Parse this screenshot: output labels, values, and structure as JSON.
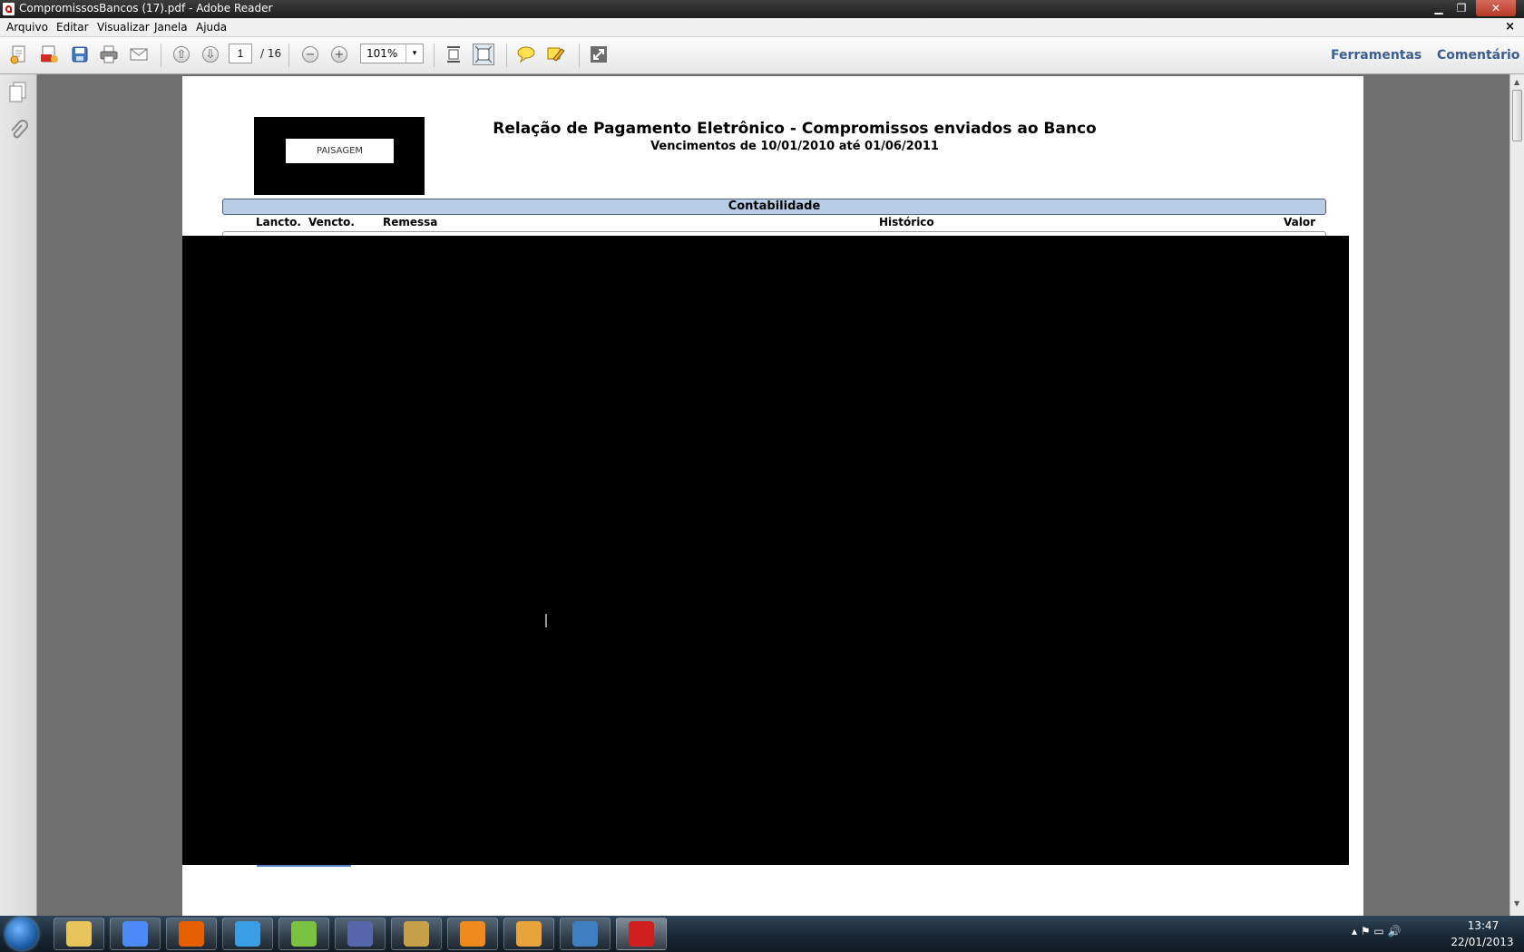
{
  "window": {
    "title": "CompromissosBancos (17).pdf - Adobe Reader",
    "min": "▁",
    "max": "❐",
    "close": "✕"
  },
  "menu": {
    "items": [
      "Arquivo",
      "Editar",
      "Visualizar",
      "Janela",
      "Ajuda"
    ],
    "close": "×"
  },
  "toolbar": {
    "page_current": "1",
    "page_total": "/ 16",
    "zoom": "101%",
    "zoom_arrow": "▾",
    "tools_label": "Ferramentas",
    "comment_label": "Comentário",
    "prev_glyph": "⇧",
    "next_glyph": "⇩",
    "zoom_out_glyph": "−",
    "zoom_in_glyph": "+"
  },
  "document": {
    "logo_text": "PAISAGEM",
    "title": "Relação de Pagamento Eletrônico - Compromissos enviados ao Banco",
    "subtitle": "Vencimentos de 10/01/2010 até 01/06/2011",
    "section": "Contabilidade",
    "columns": [
      "Lancto.",
      "Vencto.",
      "Remessa",
      "Histórico",
      "Valor"
    ]
  },
  "scrollbar": {
    "up": "▲",
    "down": "▼"
  },
  "taskbar": {
    "apps": [
      {
        "name": "explorer",
        "color": "#e8c45a",
        "active": false
      },
      {
        "name": "chrome",
        "color": "#4c8bf5",
        "active": false
      },
      {
        "name": "firefox",
        "color": "#e66000",
        "active": false
      },
      {
        "name": "internet-explorer",
        "color": "#3a9ee4",
        "active": false
      },
      {
        "name": "notepad",
        "color": "#7cc242",
        "active": false
      },
      {
        "name": "infinity",
        "color": "#5566aa",
        "active": false
      },
      {
        "name": "tools",
        "color": "#c9a04a",
        "active": false
      },
      {
        "name": "flame",
        "color": "#f08a1c",
        "active": false
      },
      {
        "name": "media",
        "color": "#e8a33a",
        "active": false
      },
      {
        "name": "s-app",
        "color": "#3f7fbf",
        "active": false
      },
      {
        "name": "adobe-reader",
        "color": "#d11f1f",
        "active": true
      }
    ],
    "tray": "▴  ⚑  ▭  🔊",
    "time": "13:47",
    "date": "22/01/2013"
  },
  "colors": {
    "section_bar": "#b7cde6",
    "link": "#3c5e8e",
    "redaction": "#000000"
  }
}
